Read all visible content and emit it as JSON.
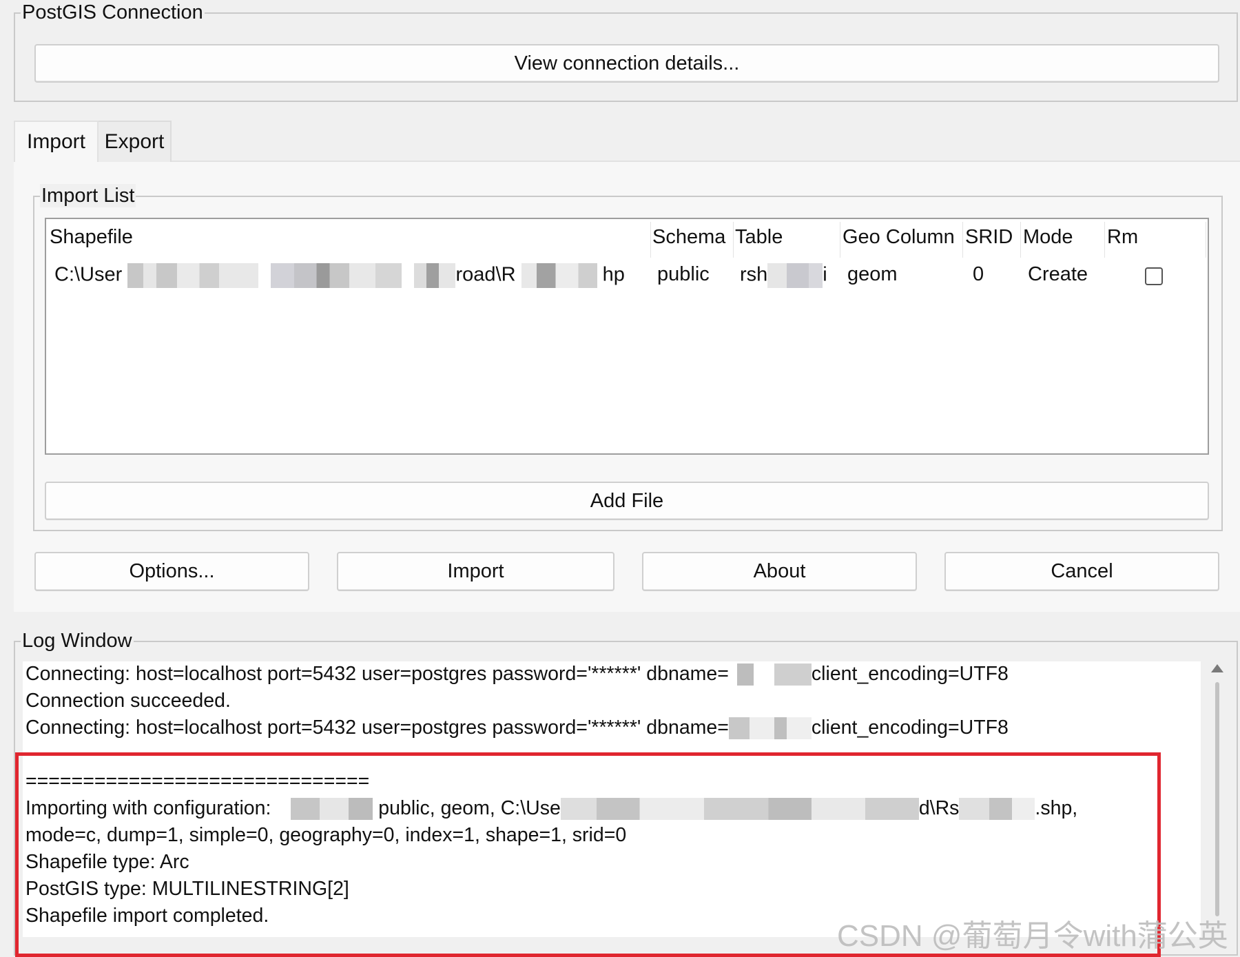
{
  "connection": {
    "legend": "PostGIS Connection",
    "view_details_button": "View connection details..."
  },
  "tabs": [
    {
      "label": "Import",
      "active": true
    },
    {
      "label": "Export",
      "active": false
    }
  ],
  "import_list": {
    "legend": "Import List",
    "columns": [
      "Shapefile",
      "Schema",
      "Table",
      "Geo Column",
      "SRID",
      "Mode",
      "Rm"
    ],
    "rows": [
      {
        "shapefile_start": "C:\\User",
        "shapefile_mid": "road\\R",
        "shapefile_end": "hp",
        "schema": "public",
        "table_start": "rsh",
        "table_end": "i",
        "geo_column": "geom",
        "srid": "0",
        "mode": "Create",
        "rm": false
      }
    ],
    "add_file_button": "Add File"
  },
  "actions": {
    "options": "Options...",
    "import": "Import",
    "about": "About",
    "cancel": "Cancel"
  },
  "log": {
    "legend": "Log Window",
    "line1_start": "Connecting:  host=localhost port=5432 user=postgres password='******' dbname=",
    "line1_end": "client_encoding=UTF8",
    "line2": "Connection succeeded.",
    "line3_start": "Connecting:  host=localhost port=5432 user=postgres password='******' dbname=",
    "line3_end": "client_encoding=UTF8",
    "separator": "==============================",
    "line5_start": "Importing with configuration:",
    "line5_mid": "public, geom, C:\\Use",
    "line5_mid2": "d\\Rs",
    "line5_end": ".shp,",
    "line6": "mode=c, dump=1, simple=0, geography=0, index=1, shape=1, srid=0",
    "line7": "Shapefile type: Arc",
    "line8": "PostGIS type: MULTILINESTRING[2]",
    "line9": "Shapefile import completed."
  },
  "watermark": "CSDN @葡萄月令with蒲公英",
  "highlight_color": "#e0262f"
}
